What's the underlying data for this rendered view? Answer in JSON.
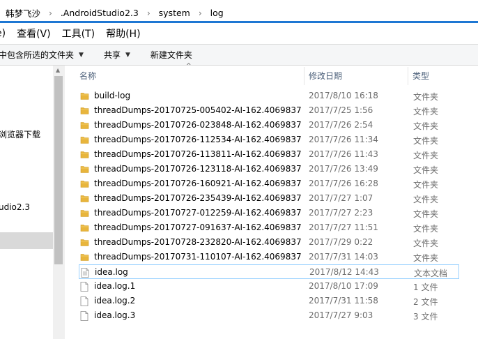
{
  "address": {
    "breadcrumbs": [
      "韩梦飞沙",
      ".AndroidStudio2.3",
      "system",
      "log"
    ],
    "separator": "›"
  },
  "menu": [
    "查看(V)",
    "工具(T)",
    "帮助(H)"
  ],
  "menu_partial": "e)",
  "toolbar": {
    "include_label": "中包含所选的文件夹",
    "share_label": "共享",
    "new_folder_label": "新建文件夹",
    "caret": "▼"
  },
  "nav": {
    "item_browser": "浏览器下载",
    "item_studio": "udio2.3",
    "selected": true
  },
  "columns": {
    "name": "名称",
    "date": "修改日期",
    "type": "类型",
    "sort_glyph": "^"
  },
  "files": [
    {
      "name": "build-log",
      "date": "2017/8/10 16:18",
      "type": "文件夹",
      "kind": "folder"
    },
    {
      "name": "threadDumps-20170725-005402-AI-162.4069837",
      "date": "2017/7/25 1:56",
      "type": "文件夹",
      "kind": "folder"
    },
    {
      "name": "threadDumps-20170726-023848-AI-162.4069837",
      "date": "2017/7/26 2:54",
      "type": "文件夹",
      "kind": "folder"
    },
    {
      "name": "threadDumps-20170726-112534-AI-162.4069837",
      "date": "2017/7/26 11:34",
      "type": "文件夹",
      "kind": "folder"
    },
    {
      "name": "threadDumps-20170726-113811-AI-162.4069837",
      "date": "2017/7/26 11:43",
      "type": "文件夹",
      "kind": "folder"
    },
    {
      "name": "threadDumps-20170726-123118-AI-162.4069837",
      "date": "2017/7/26 13:49",
      "type": "文件夹",
      "kind": "folder"
    },
    {
      "name": "threadDumps-20170726-160921-AI-162.4069837",
      "date": "2017/7/26 16:28",
      "type": "文件夹",
      "kind": "folder"
    },
    {
      "name": "threadDumps-20170726-235439-AI-162.4069837",
      "date": "2017/7/27 1:07",
      "type": "文件夹",
      "kind": "folder"
    },
    {
      "name": "threadDumps-20170727-012259-AI-162.4069837",
      "date": "2017/7/27 2:23",
      "type": "文件夹",
      "kind": "folder"
    },
    {
      "name": "threadDumps-20170727-091637-AI-162.4069837",
      "date": "2017/7/27 11:51",
      "type": "文件夹",
      "kind": "folder"
    },
    {
      "name": "threadDumps-20170728-232820-AI-162.4069837",
      "date": "2017/7/29 0:22",
      "type": "文件夹",
      "kind": "folder"
    },
    {
      "name": "threadDumps-20170731-110107-AI-162.4069837",
      "date": "2017/7/31 14:03",
      "type": "文件夹",
      "kind": "folder"
    },
    {
      "name": "idea.log",
      "date": "2017/8/12 14:43",
      "type": "文本文档",
      "kind": "text-file",
      "selected": true
    },
    {
      "name": "idea.log.1",
      "date": "2017/8/10 17:09",
      "type": "1 文件",
      "kind": "file"
    },
    {
      "name": "idea.log.2",
      "date": "2017/7/31 11:58",
      "type": "2 文件",
      "kind": "file"
    },
    {
      "name": "idea.log.3",
      "date": "2017/7/27 9:03",
      "type": "3 文件",
      "kind": "file"
    }
  ],
  "colors": {
    "accent": "#1e77d3",
    "folder": "#e8b53c",
    "header_text": "#4c607a",
    "selection_border": "#99d1ff"
  },
  "icons": {
    "folder": "folder-icon",
    "text_file": "text-file-icon",
    "file": "file-icon"
  }
}
